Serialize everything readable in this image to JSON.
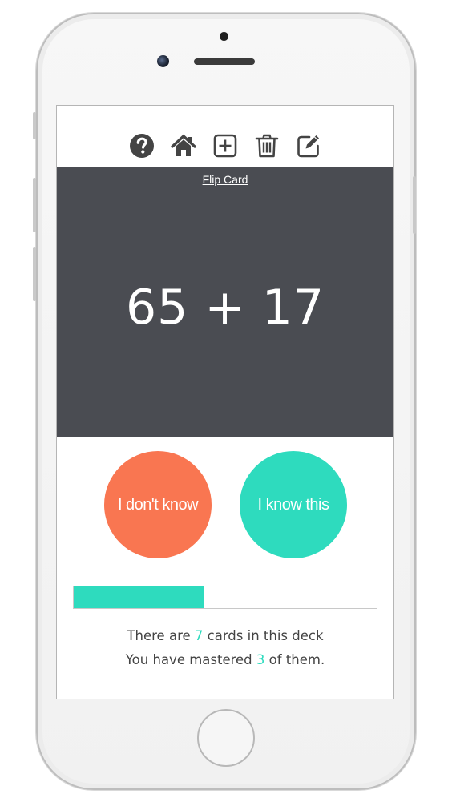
{
  "toolbar": {
    "icons": [
      "help-icon",
      "home-icon",
      "add-icon",
      "trash-icon",
      "edit-icon"
    ]
  },
  "card": {
    "flip_label": "Flip Card",
    "question": "65 + 17"
  },
  "buttons": {
    "dont_know_label": "I don't know",
    "know_label": "I know this"
  },
  "progress": {
    "mastered_fraction": 0.4286
  },
  "stats": {
    "line1_prefix": "There are ",
    "card_count": "7",
    "line1_suffix": " cards in this deck",
    "line2_prefix": "You have mastered ",
    "mastered_count": "3",
    "line2_suffix": " of them."
  },
  "colors": {
    "card_bg": "#4a4c52",
    "dont_know": "#f97651",
    "know": "#2edbbe",
    "accent": "#2edbbe",
    "text": "#444444"
  }
}
